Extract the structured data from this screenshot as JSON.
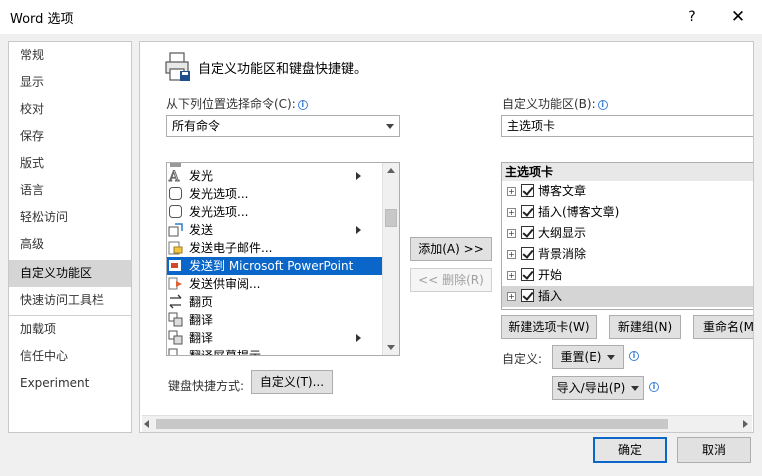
{
  "window": {
    "title": "Word 选项",
    "help": "?",
    "close": "✕"
  },
  "nav": {
    "items": [
      {
        "label": "常规"
      },
      {
        "label": "显示"
      },
      {
        "label": "校对"
      },
      {
        "label": "保存"
      },
      {
        "label": "版式"
      },
      {
        "label": "语言"
      },
      {
        "label": "轻松访问"
      },
      {
        "label": "高级"
      },
      {
        "label": "自定义功能区"
      },
      {
        "label": "快速访问工具栏"
      },
      {
        "label": "加载项"
      },
      {
        "label": "信任中心"
      },
      {
        "label": "Experiment"
      }
    ],
    "active": "自定义功能区"
  },
  "header": {
    "title": "自定义功能区和键盘快捷键。"
  },
  "left": {
    "choose_label": "从下列位置选择命令(C):",
    "choose_value": "所有命令",
    "commands": [
      {
        "label": "",
        "icon": "partial-icon"
      },
      {
        "label": "发光",
        "icon": "glow-icon",
        "submenu": true
      },
      {
        "label": "发光选项...",
        "icon": "glow-options-icon"
      },
      {
        "label": "发光选项...",
        "icon": "glow-options-icon"
      },
      {
        "label": "发送",
        "icon": "send-icon",
        "submenu": true
      },
      {
        "label": "发送电子邮件...",
        "icon": "email-icon"
      },
      {
        "label": "发送到 Microsoft PowerPoint",
        "icon": "powerpoint-icon",
        "selected": true
      },
      {
        "label": "发送供审阅...",
        "icon": "review-icon"
      },
      {
        "label": "翻页",
        "icon": "page-flip-icon"
      },
      {
        "label": "翻译",
        "icon": "translate-icon"
      },
      {
        "label": "翻译",
        "icon": "translate-icon",
        "submenu": true
      },
      {
        "label": "翻译屏幕提示",
        "icon": "translate-tip-icon"
      }
    ],
    "shortcut_label": "键盘快捷方式:",
    "shortcut_button": "自定义(T)..."
  },
  "middle": {
    "add_button": "添加(A) >>",
    "remove_button": "<< 删除(R)"
  },
  "right": {
    "customize_label": "自定义功能区(B):",
    "customize_value": "主选项卡",
    "tree_header": "主选项卡",
    "tabs": [
      {
        "label": "博客文章",
        "checked": true
      },
      {
        "label": "插入(博客文章)",
        "checked": true
      },
      {
        "label": "大纲显示",
        "checked": true
      },
      {
        "label": "背景消除",
        "checked": true
      },
      {
        "label": "开始",
        "checked": true
      },
      {
        "label": "插入",
        "checked": true,
        "selected": true
      }
    ],
    "new_tab_button": "新建选项卡(W)",
    "new_group_button": "新建组(N)",
    "rename_button": "重命名(M)...",
    "customizations_label": "自定义:",
    "reset_button": "重置(E)",
    "import_export_button": "导入/导出(P)"
  },
  "footer": {
    "ok": "确定",
    "cancel": "取消"
  },
  "colors": {
    "accent": "#0a66c8",
    "selected_nav": "#d5d5d5"
  }
}
